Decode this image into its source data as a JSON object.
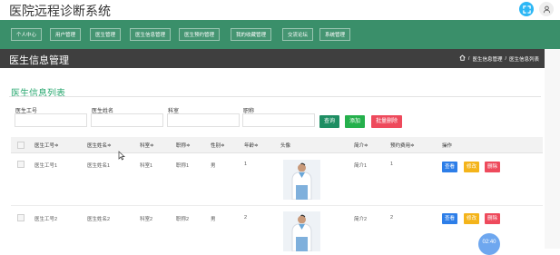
{
  "app": {
    "title": "医院远程诊断系统"
  },
  "topbar": {
    "fullscreen_icon": "fullscreen-icon",
    "user_icon": "user-icon"
  },
  "nav": {
    "items": [
      "个人中心",
      "用户管理",
      "医生管理",
      "医生信息管理",
      "医生预约管理",
      "我的收藏管理",
      "交流论坛",
      "系统管理"
    ]
  },
  "header": {
    "page_title": "医生信息管理",
    "breadcrumb": [
      "医生信息管理",
      "医生信息列表"
    ]
  },
  "section": {
    "title": "医生信息列表"
  },
  "search": {
    "fields": [
      {
        "label": "医生工号",
        "value": ""
      },
      {
        "label": "医生姓名",
        "value": ""
      },
      {
        "label": "科室",
        "value": ""
      },
      {
        "label": "职称",
        "value": ""
      }
    ],
    "buttons": {
      "search": "查询",
      "add": "添加",
      "batch_delete": "批量删除"
    }
  },
  "table": {
    "headers": [
      "医生工号≑",
      "医生姓名≑",
      "科室≑",
      "职称≑",
      "性别≑",
      "年龄≑",
      "头像",
      "简介≑",
      "预约费用≑",
      "操作"
    ],
    "rows": [
      {
        "id": "医生工号1",
        "name": "医生姓名1",
        "dept": "科室1",
        "title": "职称1",
        "gender": "男",
        "age": "1",
        "intro": "简介1",
        "fee": "1"
      },
      {
        "id": "医生工号2",
        "name": "医生姓名2",
        "dept": "科室2",
        "title": "职称2",
        "gender": "男",
        "age": "2",
        "intro": "简介2",
        "fee": "2"
      }
    ],
    "actions": {
      "view": "查看",
      "edit": "修改",
      "delete": "删除"
    }
  },
  "float_badge": "02:40",
  "colors": {
    "nav": "#3a8f6a",
    "accent": "#2aa870",
    "header": "#3f3f3f"
  }
}
